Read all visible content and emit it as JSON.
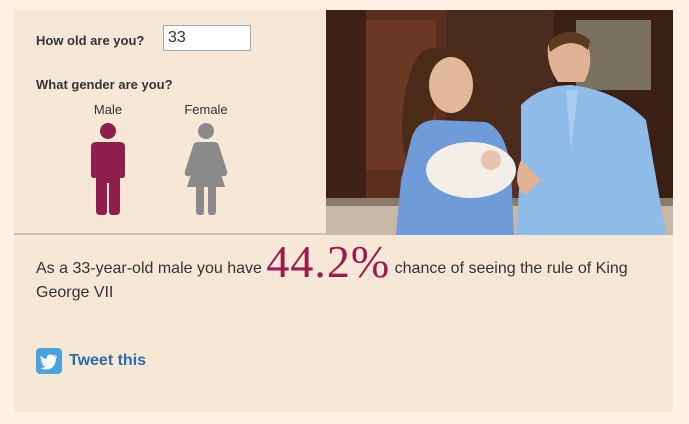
{
  "form": {
    "age_label": "How old are you?",
    "age_value": "33",
    "gender_label": "What gender are you?"
  },
  "genders": {
    "male": {
      "label": "Male",
      "color": "#8e1e4c",
      "selected": true
    },
    "female": {
      "label": "Female",
      "color": "#8a8a8a",
      "selected": false
    }
  },
  "result": {
    "prefix": "As a 33-year-old male you have",
    "percent": "44.2%",
    "suffix": "chance of seeing the rule of King George VII"
  },
  "share": {
    "label": "Tweet this",
    "icon": "twitter-bird-icon",
    "color": "#2d6ba8"
  },
  "photo": {
    "icon": "royal-family-photo"
  }
}
